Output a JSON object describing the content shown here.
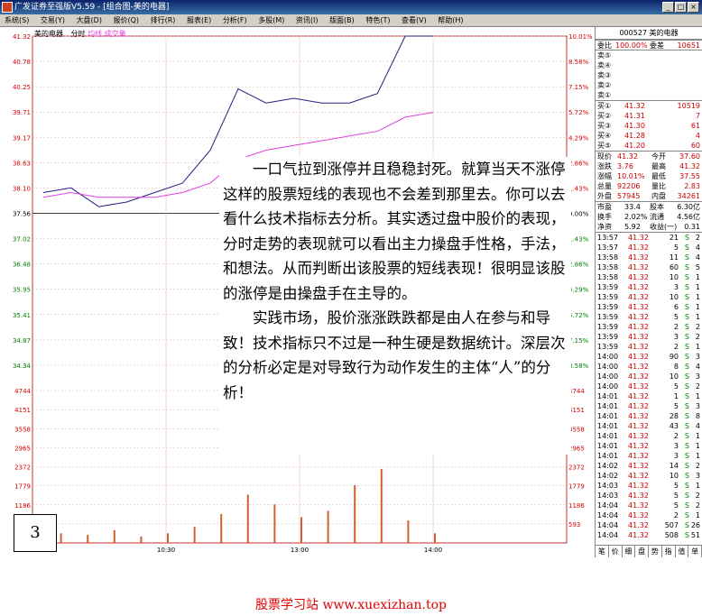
{
  "window": {
    "title": "广发证券至强版V5.59 - [组合图-美的电器]",
    "controls": [
      "_",
      "□",
      "×"
    ]
  },
  "menu": [
    "系统(S)",
    "交易(Y)",
    "大盘(D)",
    "报价(Q)",
    "排行(R)",
    "报表(E)",
    "分析(F)",
    "多股(M)",
    "资讯(I)",
    "版面(B)",
    "特色(T)",
    "查看(V)",
    "帮助(H)"
  ],
  "chart_header": {
    "stock": "美的电器",
    "mode": "分时",
    "avg_label": "均线",
    "vol_label": "成交量"
  },
  "price_axis": {
    "left": [
      "41.32",
      "40.78",
      "40.25",
      "39.71",
      "39.17",
      "38.63",
      "38.10",
      "37.56",
      "37.02",
      "36.48",
      "35.95",
      "35.41",
      "34.87",
      "34.34"
    ],
    "right": [
      "10.01%",
      "8.58%",
      "7.15%",
      "5.72%",
      "4.29%",
      "2.86%",
      "1.43%",
      "0.00%",
      "1.43%",
      "2.86%",
      "4.29%",
      "5.72%",
      "7.15%",
      "8.58%"
    ]
  },
  "volume_axis": {
    "left": [
      "4744",
      "4151",
      "3558",
      "2965",
      "2372",
      "1779",
      "1186",
      "593"
    ],
    "right": [
      "4744",
      "4151",
      "3558",
      "2965",
      "2372",
      "1779",
      "1186",
      "593"
    ]
  },
  "time_axis": [
    "09:30",
    "10:30",
    "13:00",
    "14:00"
  ],
  "chart_data": {
    "type": "line",
    "x": [
      "09:30",
      "09:45",
      "10:00",
      "10:15",
      "10:30",
      "10:45",
      "11:00",
      "11:15",
      "11:30",
      "13:00",
      "13:15",
      "13:30",
      "13:45",
      "14:00",
      "14:10"
    ],
    "series": [
      {
        "values": [
          38.0,
          38.1,
          37.7,
          37.8,
          38.0,
          38.2,
          38.9,
          40.2,
          39.9,
          40.0,
          39.9,
          39.9,
          40.1,
          41.32,
          41.32
        ]
      },
      {
        "values": [
          37.9,
          38.0,
          37.9,
          37.9,
          37.9,
          38.0,
          38.2,
          38.7,
          38.9,
          39.0,
          39.1,
          39.2,
          39.3,
          39.6,
          39.7
        ]
      }
    ],
    "ylim": [
      34.34,
      41.32
    ],
    "volume": [
      593,
      300,
      250,
      400,
      200,
      300,
      500,
      900,
      1500,
      1200,
      800,
      1000,
      1800,
      2300,
      700,
      300
    ]
  },
  "quote": {
    "code_name": "000527 美的电器",
    "weibi_label": "委比",
    "weibi": "100.00%",
    "weicha_label": "委差",
    "weicha": "10651",
    "sell": [
      "卖⑤",
      "卖④",
      "卖③",
      "卖②",
      "卖①"
    ],
    "buy": [
      {
        "label": "买①",
        "price": "41.32",
        "vol": "10519"
      },
      {
        "label": "买②",
        "price": "41.31",
        "vol": "7"
      },
      {
        "label": "买③",
        "price": "41.30",
        "vol": "61"
      },
      {
        "label": "买④",
        "price": "41.28",
        "vol": "4"
      },
      {
        "label": "买⑤",
        "price": "41.20",
        "vol": "60"
      }
    ],
    "stats": [
      [
        "现价",
        "41.32",
        "今开",
        "37.60"
      ],
      [
        "涨跌",
        "3.76",
        "最高",
        "41.32"
      ],
      [
        "涨幅",
        "10.01%",
        "最低",
        "37.55"
      ],
      [
        "总量",
        "92206",
        "量比",
        "2.83"
      ],
      [
        "外盘",
        "57945",
        "内盘",
        "34261"
      ]
    ],
    "stats2": [
      [
        "市盈",
        "33.4",
        "股本",
        "6.30亿"
      ],
      [
        "换手",
        "2.02%",
        "流通",
        "4.56亿"
      ],
      [
        "净资",
        "5.92",
        "收益(一)",
        "0.31"
      ]
    ],
    "ticks": [
      [
        "13:57",
        "41.32",
        "21",
        "S",
        "2"
      ],
      [
        "13:57",
        "41.32",
        "5",
        "S",
        "4"
      ],
      [
        "13:58",
        "41.32",
        "11",
        "S",
        "4"
      ],
      [
        "13:58",
        "41.32",
        "60",
        "S",
        "5"
      ],
      [
        "13:58",
        "41.32",
        "10",
        "S",
        "1"
      ],
      [
        "13:59",
        "41.32",
        "3",
        "S",
        "1"
      ],
      [
        "13:59",
        "41.32",
        "10",
        "S",
        "1"
      ],
      [
        "13:59",
        "41.32",
        "6",
        "S",
        "1"
      ],
      [
        "13:59",
        "41.32",
        "5",
        "S",
        "1"
      ],
      [
        "13:59",
        "41.32",
        "2",
        "S",
        "2"
      ],
      [
        "13:59",
        "41.32",
        "3",
        "S",
        "2"
      ],
      [
        "13:59",
        "41.32",
        "2",
        "S",
        "1"
      ],
      [
        "14:00",
        "41.32",
        "90",
        "S",
        "3"
      ],
      [
        "14:00",
        "41.32",
        "8",
        "S",
        "4"
      ],
      [
        "14:00",
        "41.32",
        "10",
        "S",
        "3"
      ],
      [
        "14:00",
        "41.32",
        "5",
        "S",
        "2"
      ],
      [
        "14:01",
        "41.32",
        "1",
        "S",
        "1"
      ],
      [
        "14:01",
        "41.32",
        "5",
        "S",
        "3"
      ],
      [
        "14:01",
        "41.32",
        "28",
        "S",
        "8"
      ],
      [
        "14:01",
        "41.32",
        "43",
        "S",
        "4"
      ],
      [
        "14:01",
        "41.32",
        "2",
        "S",
        "1"
      ],
      [
        "14:01",
        "41.32",
        "3",
        "S",
        "1"
      ],
      [
        "14:01",
        "41.32",
        "3",
        "S",
        "1"
      ],
      [
        "14:02",
        "41.32",
        "14",
        "S",
        "2"
      ],
      [
        "14:02",
        "41.32",
        "10",
        "S",
        "3"
      ],
      [
        "14:03",
        "41.32",
        "5",
        "S",
        "1"
      ],
      [
        "14:03",
        "41.32",
        "5",
        "S",
        "2"
      ],
      [
        "14:04",
        "41.32",
        "5",
        "S",
        "2"
      ],
      [
        "14:04",
        "41.32",
        "2",
        "S",
        "1"
      ],
      [
        "14:04",
        "41.32",
        "507",
        "S",
        "26"
      ],
      [
        "14:04",
        "41.32",
        "508",
        "S",
        "51"
      ]
    ],
    "tabs": [
      "笔",
      "价",
      "细",
      "盘",
      "势",
      "指",
      "值",
      "单"
    ]
  },
  "overlay_text": {
    "p1": "一口气拉到涨停并且稳稳封死。就算当天不涨停这样的股票短线的表现也不会差到那里去。你可以去看什么技术指标去分析。其实透过盘中股价的表现，分时走势的表现就可以看出主力操盘手性格，手法，和想法。从而判断出该股票的短线表现！很明显该股的涨停是由操盘手在主导的。",
    "p2": "实践市场，股价涨涨跌跌都是由人在参与和导致！技术指标只不过是一种生硬是数据统计。深层次的分析必定是对导致行为动作发生的主体“人”的分析！"
  },
  "page_number": "3",
  "footer": "股票学习站   www.xuexizhan.top",
  "colors": {
    "price": "#202080",
    "avg": "#e040e0",
    "up": "#d00000",
    "vol": "#d06030"
  }
}
